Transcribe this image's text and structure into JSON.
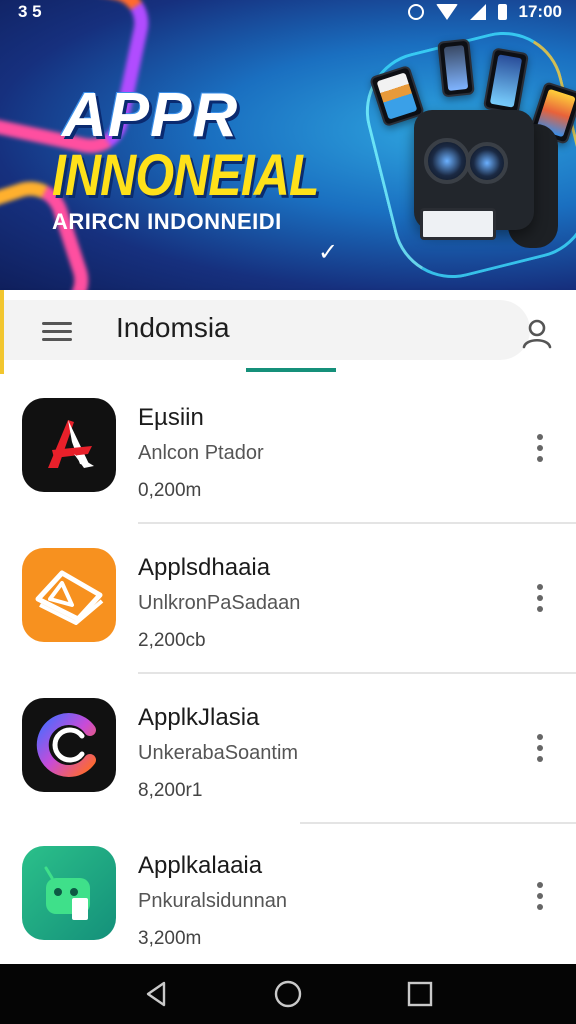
{
  "status_bar": {
    "left_text": "3 5",
    "time": "17:00",
    "icons": [
      "alarm-icon",
      "wifi-icon",
      "cell-signal-icon",
      "battery-icon"
    ]
  },
  "banner": {
    "title": "APPR",
    "subtitle": "INNONEIAL",
    "tagline": "ARIRCN INDONNEIDI",
    "check": "✓"
  },
  "search": {
    "query": "Indomsia",
    "menu_icon": "hamburger-menu-icon",
    "account_icon": "account-icon",
    "accent_color": "#15907a",
    "edge_color": "#f2c62e"
  },
  "apps": [
    {
      "name": "Eµsiin",
      "developer": "Anlcon Ptador",
      "count": "0,200m",
      "icon": "red-a-logo-icon",
      "bg": "#111111"
    },
    {
      "name": "Applsdhaaia",
      "developer": "UnlkronPaSadaan",
      "count": "2,200cb",
      "icon": "orange-roof-logo-icon",
      "bg": "#f7911f"
    },
    {
      "name": "ApplkJlasia",
      "developer": "UnkerabaSoantim",
      "count": "8,200r1",
      "icon": "gradient-c-logo-icon",
      "bg": "#111111"
    },
    {
      "name": "Applkalaaia",
      "developer": "Pnkuralsidunnan",
      "count": "3,200m",
      "icon": "green-android-logo-icon",
      "bg": "#1faf86"
    }
  ],
  "nav": {
    "back": "back-icon",
    "home": "home-icon",
    "recents": "recents-icon"
  }
}
